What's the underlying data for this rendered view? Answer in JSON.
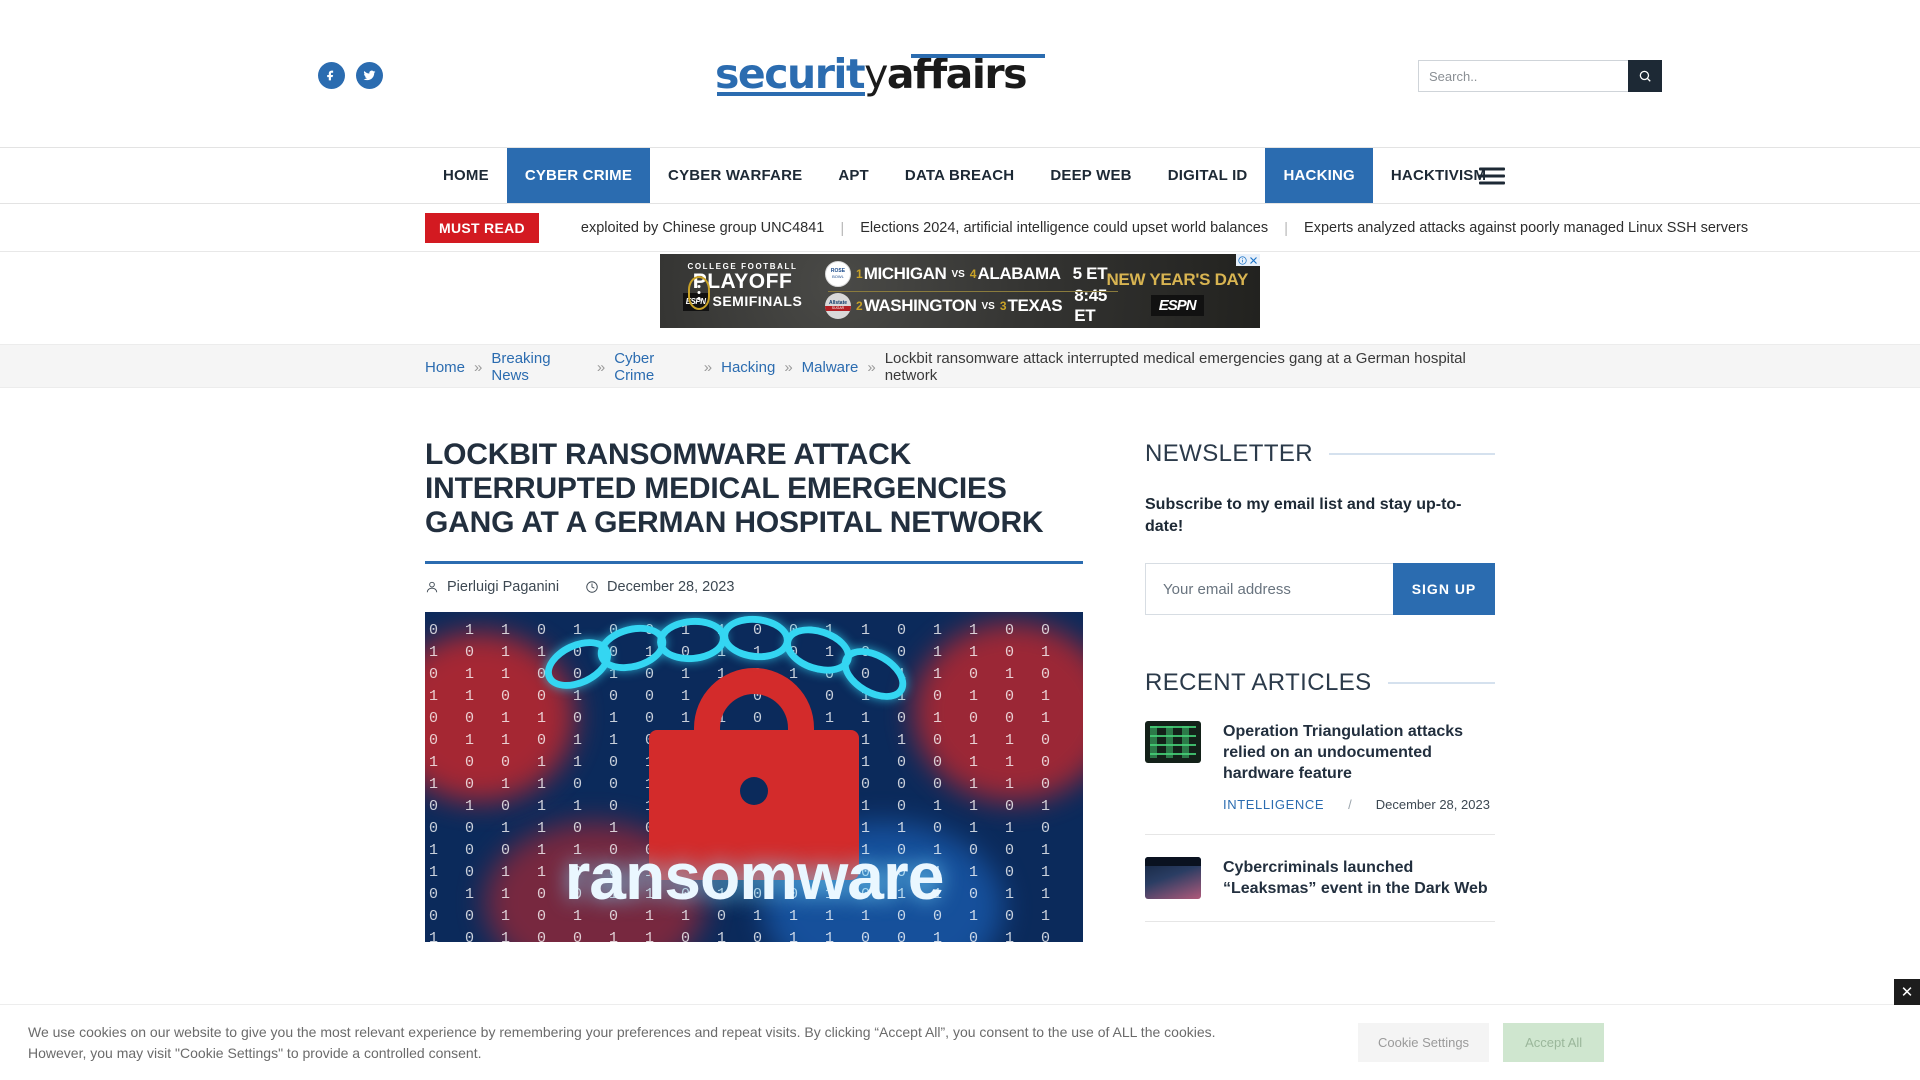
{
  "header": {
    "social": [
      {
        "name": "facebook",
        "label": "Facebook"
      },
      {
        "name": "twitter",
        "label": "Twitter"
      }
    ],
    "logo": {
      "part1": "securit",
      "part2": "y",
      "part3": "affairs"
    },
    "search": {
      "placeholder": "Search..",
      "value": "",
      "button_label": "Search"
    }
  },
  "nav": {
    "items": [
      {
        "label": "HOME",
        "active": false
      },
      {
        "label": "CYBER CRIME",
        "active": true
      },
      {
        "label": "CYBER WARFARE",
        "active": false
      },
      {
        "label": "APT",
        "active": false
      },
      {
        "label": "DATA BREACH",
        "active": false
      },
      {
        "label": "DEEP WEB",
        "active": false
      },
      {
        "label": "DIGITAL ID",
        "active": false
      },
      {
        "label": "HACKING",
        "active": true
      },
      {
        "label": "HACKTIVISM",
        "active": false
      }
    ],
    "menu_label": "Menu"
  },
  "ticker": {
    "badge": "MUST READ",
    "separator": "|",
    "items": [
      "exploited by Chinese group UNC4841",
      "Elections 2024, artificial intelligence could upset world balances",
      "Experts analyzed attacks against poorly managed Linux SSH servers"
    ]
  },
  "ad": {
    "label_college": "COLLEGE FOOTBALL",
    "label_playoff": "PLAYOFF",
    "label_semifinals": "SEMIFINALS",
    "espn_small": "ESPN",
    "espn_big": "ESPN",
    "new_years": "NEW YEAR'S DAY",
    "games": [
      {
        "seed_a": "1",
        "team_a": "MICHIGAN",
        "vs": "VS",
        "seed_b": "4",
        "team_b": "ALABAMA",
        "time": "5 ET",
        "bowl": "ROSE BOWL"
      },
      {
        "seed_a": "2",
        "team_a": "WASHINGTON",
        "vs": "VS",
        "seed_b": "3",
        "team_b": "TEXAS",
        "time": "8:45 ET",
        "bowl": "ALLSTATE SUGAR BOWL"
      }
    ],
    "adchoices": "AdChoices"
  },
  "breadcrumb": {
    "separator": "»",
    "items": [
      {
        "label": "Home",
        "current": false
      },
      {
        "label": "Breaking News",
        "current": false
      },
      {
        "label": "Cyber Crime",
        "current": false
      },
      {
        "label": "Hacking",
        "current": false
      },
      {
        "label": "Malware",
        "current": false
      },
      {
        "label": "Lockbit ransomware attack interrupted medical emergencies gang at a German hospital network",
        "current": true
      }
    ]
  },
  "article": {
    "title": "Lockbit ransomware attack interrupted medical emergencies gang at a German hospital network",
    "author": "Pierluigi Paganini",
    "date": "December 28, 2023",
    "image_word": "ransomware"
  },
  "sidebar": {
    "newsletter": {
      "heading": "NEWSLETTER",
      "subheading": "Subscribe to my email list and stay up-to-date!",
      "email_placeholder": "Your email address",
      "email_value": "",
      "signup_label": "SIGN UP"
    },
    "recent": {
      "heading": "RECENT ARTICLES",
      "slash": "/",
      "items": [
        {
          "title": "Operation Triangulation attacks relied on an undocumented hardware feature",
          "category": "INTELLIGENCE",
          "date": "December 28, 2023",
          "thumb": "code"
        },
        {
          "title": "Cybercriminals launched “Leaksmas” event in the Dark Web",
          "category": "",
          "date": "",
          "thumb": "dark"
        }
      ]
    }
  },
  "cookie": {
    "line1": "We use cookies on our website to give you the most relevant experience by remembering your preferences and repeat visits. By clicking “Accept All”, you consent to the use of ALL the cookies.",
    "line2": "However, you may visit \"Cookie Settings\" to provide a controlled consent.",
    "settings_label": "Cookie Settings",
    "accept_label": "Accept All",
    "close_label": "✕"
  },
  "colors": {
    "brand_blue": "#2b6cb0",
    "dark": "#1d2935",
    "red": "#d31a21"
  }
}
